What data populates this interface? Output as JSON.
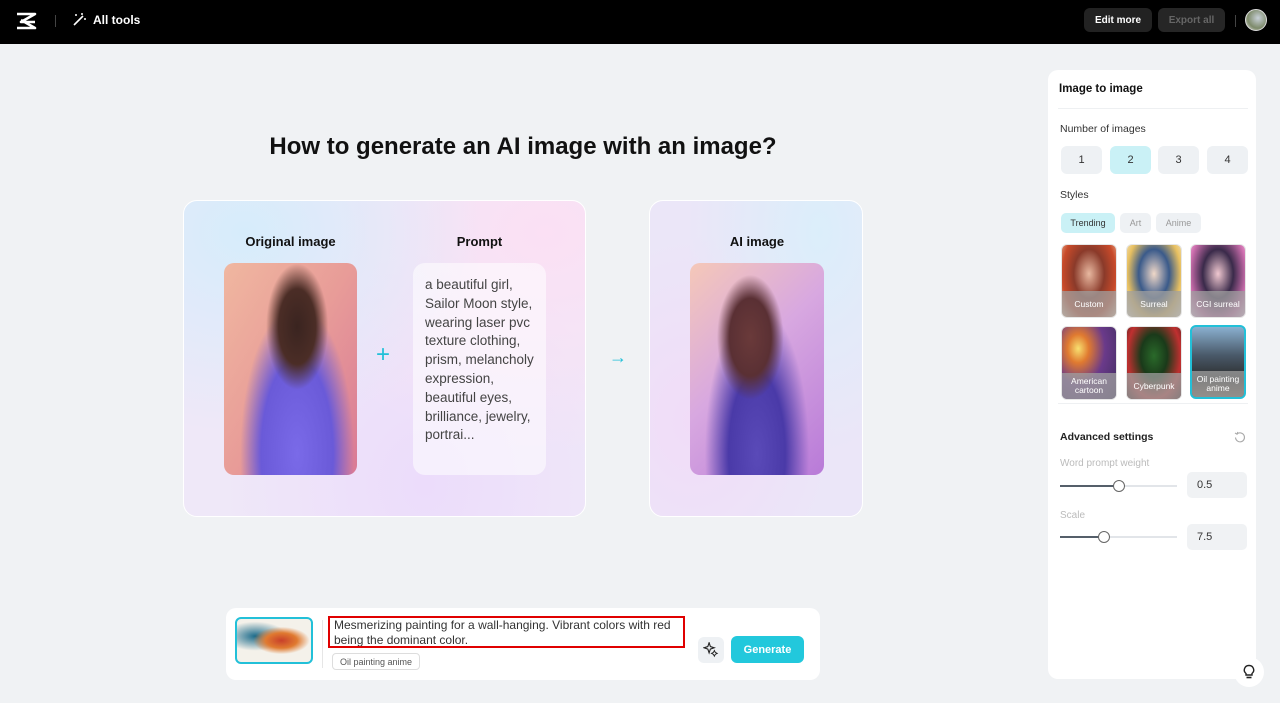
{
  "topbar": {
    "logo_icon": "capcut-logo",
    "all_tools_label": "All tools",
    "edit_more_label": "Edit more",
    "export_all_label": "Export all"
  },
  "main": {
    "heading": "How to generate an AI image with an image?",
    "original_image_label": "Original image",
    "prompt_label": "Prompt",
    "prompt_text": "a beautiful girl, Sailor Moon style, wearing laser pvc texture clothing, prism, melancholy expression, beautiful eyes, brilliance, jewelry, portrai...",
    "ai_image_label": "AI image",
    "plus_symbol": "+",
    "arrow_symbol": "→"
  },
  "prompt_bar": {
    "prompt_value": "Mesmerizing painting for a wall-hanging. Vibrant colors with red being the dominant color.",
    "style_chip": "Oil painting anime",
    "generate_label": "Generate"
  },
  "panel": {
    "title": "Image to image",
    "number_label": "Number of images",
    "numbers": [
      {
        "label": "1",
        "active": false
      },
      {
        "label": "2",
        "active": true
      },
      {
        "label": "3",
        "active": false
      },
      {
        "label": "4",
        "active": false
      }
    ],
    "styles_label": "Styles",
    "style_tabs": [
      {
        "label": "Trending",
        "active": true
      },
      {
        "label": "Art",
        "active": false
      },
      {
        "label": "Anime",
        "active": false
      }
    ],
    "styles": [
      {
        "label": "Custom",
        "selected": false
      },
      {
        "label": "Surreal",
        "selected": false
      },
      {
        "label": "CGI surreal",
        "selected": false
      },
      {
        "label": "American cartoon",
        "selected": false
      },
      {
        "label": "Cyberpunk",
        "selected": false
      },
      {
        "label": "Oil painting anime",
        "selected": true
      }
    ],
    "advanced_label": "Advanced settings",
    "word_weight_label": "Word prompt weight",
    "word_weight_value": "0.5",
    "word_weight_fraction": 0.5,
    "scale_label": "Scale",
    "scale_value": "7.5",
    "scale_fraction": 0.38
  }
}
